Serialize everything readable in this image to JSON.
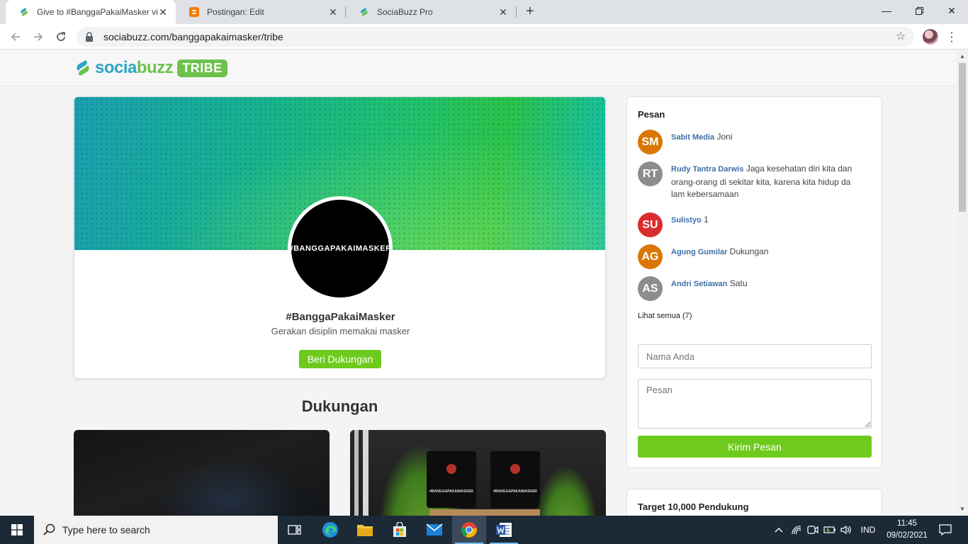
{
  "browser": {
    "tabs": [
      {
        "title": "Give to #BanggaPakaiMasker via",
        "active": true
      },
      {
        "title": "Postingan: Edit",
        "active": false
      },
      {
        "title": "SociaBuzz Pro",
        "active": false
      }
    ],
    "url": "sociabuzz.com/banggapakaimasker/tribe"
  },
  "site": {
    "logo_a": "socia",
    "logo_b": "buzz",
    "logo_badge": "TRIBE"
  },
  "profile": {
    "avatar_text": "#BANGGAPAKAIMASKER",
    "name": "#BanggaPakaiMasker",
    "description": "Gerakan disiplin memakai masker",
    "support_button": "Beri Dukungan"
  },
  "support_section": {
    "title": "Dukungan",
    "thumb_label": "#BANGGAPAKAIMASKER"
  },
  "messages": {
    "title": "Pesan",
    "items": [
      {
        "initials": "SM",
        "name": "Sabit Media",
        "text": "Joni",
        "color": "#d97706"
      },
      {
        "initials": "RT",
        "name": "Rudy Tantra Darwis",
        "text": "Jaga kesehatan diri kita dan orang-orang di sekitar kita, karena kita hidup da lam kebersamaan",
        "color": "#8d8d8d"
      },
      {
        "initials": "SU",
        "name": "Sulistyo",
        "text": "1",
        "color": "#d92c2c"
      },
      {
        "initials": "AG",
        "name": "Agung Gumilar",
        "text": "Dukungan",
        "color": "#d97706"
      },
      {
        "initials": "AS",
        "name": "Andri Setiawan",
        "text": "Satu",
        "color": "#8d8d8d"
      }
    ],
    "see_all": "Lihat semua (7)",
    "name_placeholder": "Nama Anda",
    "message_placeholder": "Pesan",
    "send_button": "Kirim Pesan"
  },
  "target": {
    "title": "Target 10,000 Pendukung"
  },
  "taskbar": {
    "search_placeholder": "Type here to search",
    "language": "IND",
    "time": "11:45",
    "date": "09/02/2021"
  },
  "colors": {
    "accent_green": "#6fca1e",
    "link_blue": "#3e6fa8",
    "brand_teal": "#2ca6c4"
  }
}
